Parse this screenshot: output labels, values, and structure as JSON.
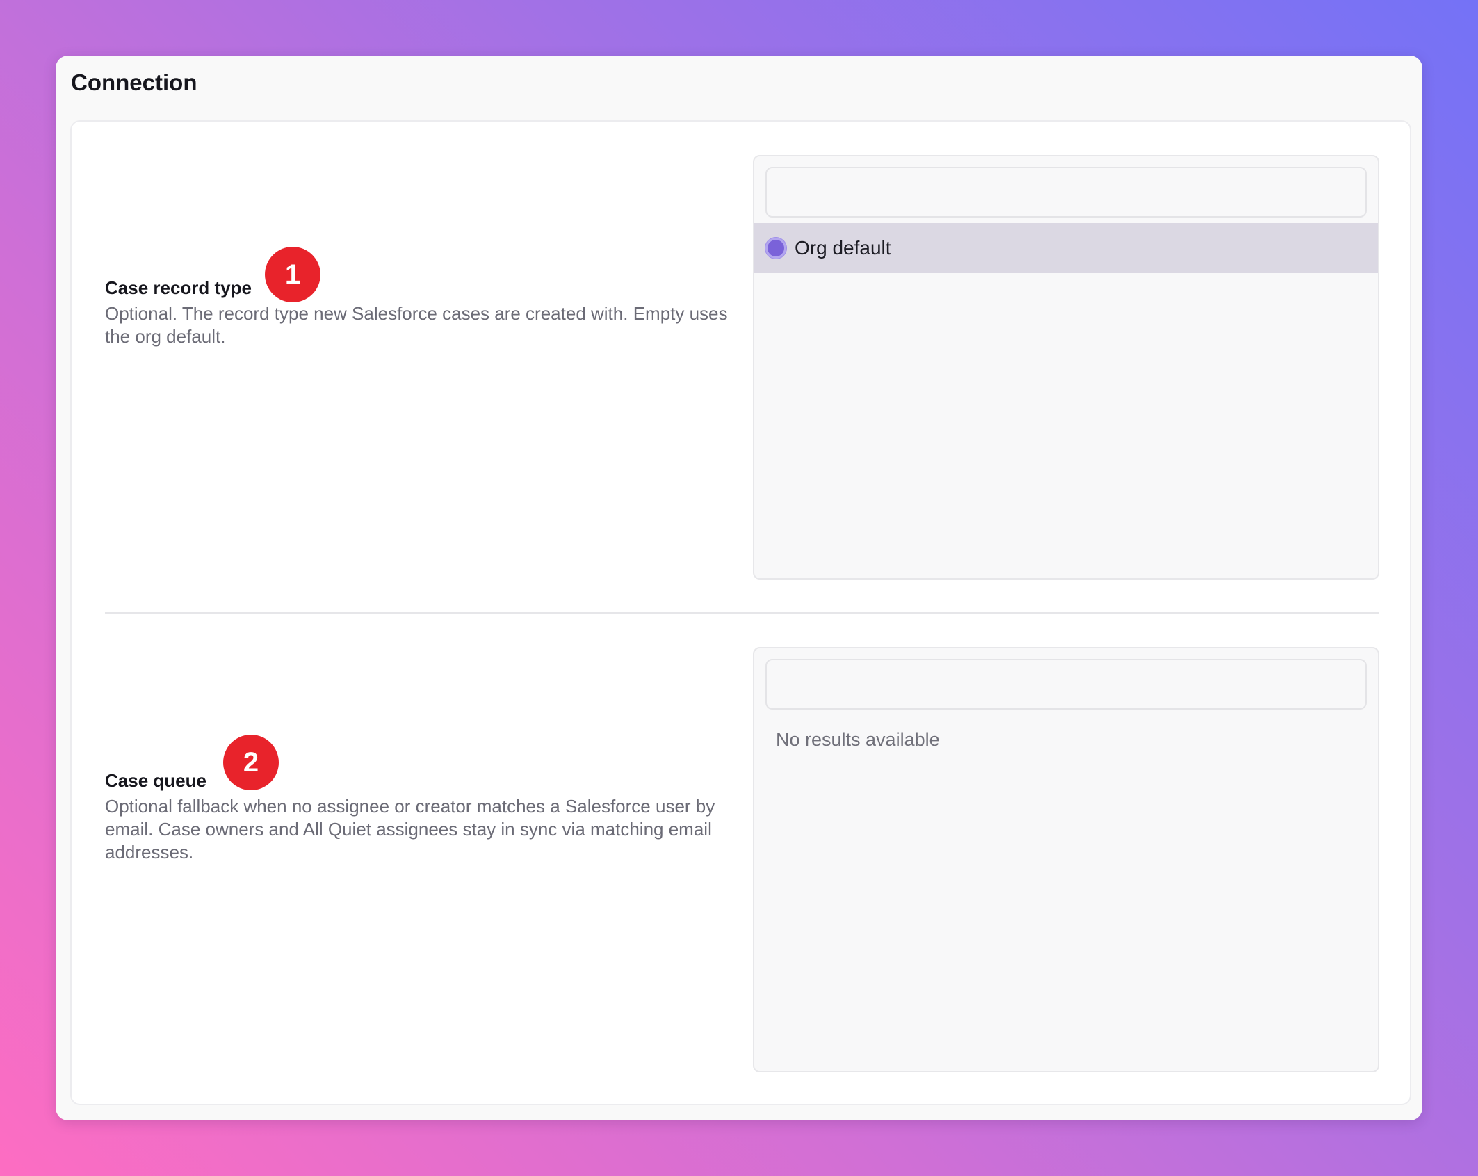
{
  "card": {
    "title": "Connection"
  },
  "fields": [
    {
      "label": "Case record type",
      "badge": "1",
      "description": "Optional. The record type new Salesforce cases are created with. Empty uses the org default.",
      "search_value": "",
      "options": [
        {
          "label": "Org default",
          "selected": true
        }
      ]
    },
    {
      "label": "Case queue",
      "badge": "2",
      "description": "Optional fallback when no assignee or creator matches a Salesforce user by email. Case owners and All Quiet assignees stay in sync via matching email addresses.",
      "search_value": "",
      "empty_text": "No results available"
    }
  ],
  "colors": {
    "badge": "#e8232b",
    "accent": "#7a62d9",
    "selected_row": "#dbd8e3"
  }
}
